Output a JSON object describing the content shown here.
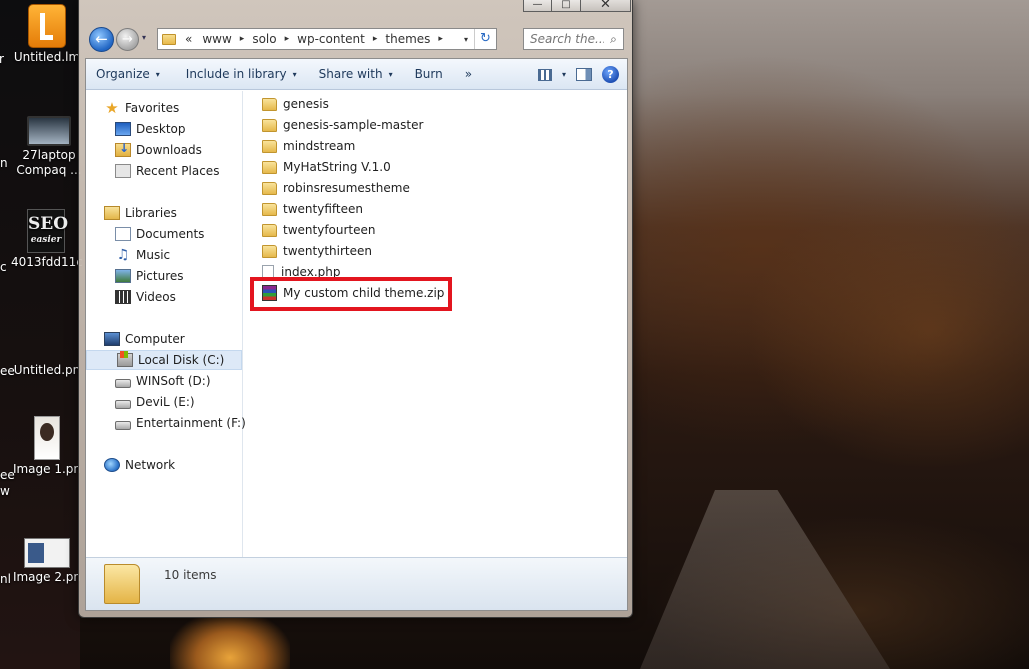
{
  "desktop": {
    "icons": [
      {
        "label": "Untitled.lm",
        "icon": "orange-app-icon"
      },
      {
        "label_line1": "27laptop",
        "label_line2": "Compaq ...",
        "icon": "laptop-icon"
      },
      {
        "label": "4013fdd11c",
        "icon": "seo-easier-icon",
        "icon_text": "SEO",
        "icon_subtext": "easier"
      },
      {
        "label": "Untitled.pn",
        "icon": "blank-image-icon"
      },
      {
        "label": "Image 1.pn",
        "icon": "photo-icon"
      },
      {
        "label": "Image 2.pn",
        "icon": "screenshot-icon"
      }
    ],
    "edge_labels": [
      "r",
      "n",
      "c",
      "ee",
      "ee",
      "w",
      "nl"
    ]
  },
  "window": {
    "controls": {
      "minimize": "—",
      "maximize": "□",
      "close": "✕"
    },
    "nav": {
      "back": "←",
      "forward": "→",
      "dropdown": "▾"
    },
    "address": {
      "overflow": "«",
      "crumbs": [
        "www",
        "solo",
        "wp-content",
        "themes"
      ],
      "separator": "▸",
      "dropdown": "▾",
      "refresh": "↻"
    },
    "search": {
      "placeholder": "Search the...",
      "icon": "⌕"
    },
    "toolbar": {
      "organize": "Organize",
      "include_in_library": "Include in library",
      "share_with": "Share with",
      "burn": "Burn",
      "more": "»",
      "dropdown": "▾",
      "help": "?"
    },
    "nav_pane": {
      "favorites": "Favorites",
      "desktop": "Desktop",
      "downloads": "Downloads",
      "recent_places": "Recent Places",
      "libraries": "Libraries",
      "documents": "Documents",
      "music": "Music",
      "pictures": "Pictures",
      "videos": "Videos",
      "computer": "Computer",
      "local_disk_c": "Local Disk (C:)",
      "winsoft_d": "WINSoft (D:)",
      "devil_e": "DeviL (E:)",
      "entertainment_f": "Entertainment (F:)",
      "network": "Network",
      "star_glyph": "★",
      "music_glyph": "♫"
    },
    "files": [
      {
        "name": "genesis",
        "type": "folder"
      },
      {
        "name": "genesis-sample-master",
        "type": "folder"
      },
      {
        "name": "mindstream",
        "type": "folder"
      },
      {
        "name": "MyHatString V.1.0",
        "type": "folder"
      },
      {
        "name": "robinsresumestheme",
        "type": "folder"
      },
      {
        "name": "twentyfifteen",
        "type": "folder"
      },
      {
        "name": "twentyfourteen",
        "type": "folder"
      },
      {
        "name": "twentythirteen",
        "type": "folder"
      },
      {
        "name": "index.php",
        "type": "php-file"
      },
      {
        "name": "My custom child theme.zip",
        "type": "zip-archive",
        "highlighted": true
      }
    ],
    "status": {
      "item_count": "10 items"
    },
    "colors": {
      "highlight_border": "#e3151f",
      "selection": "#dde9f7",
      "toolbar_text": "#1e395b"
    }
  }
}
